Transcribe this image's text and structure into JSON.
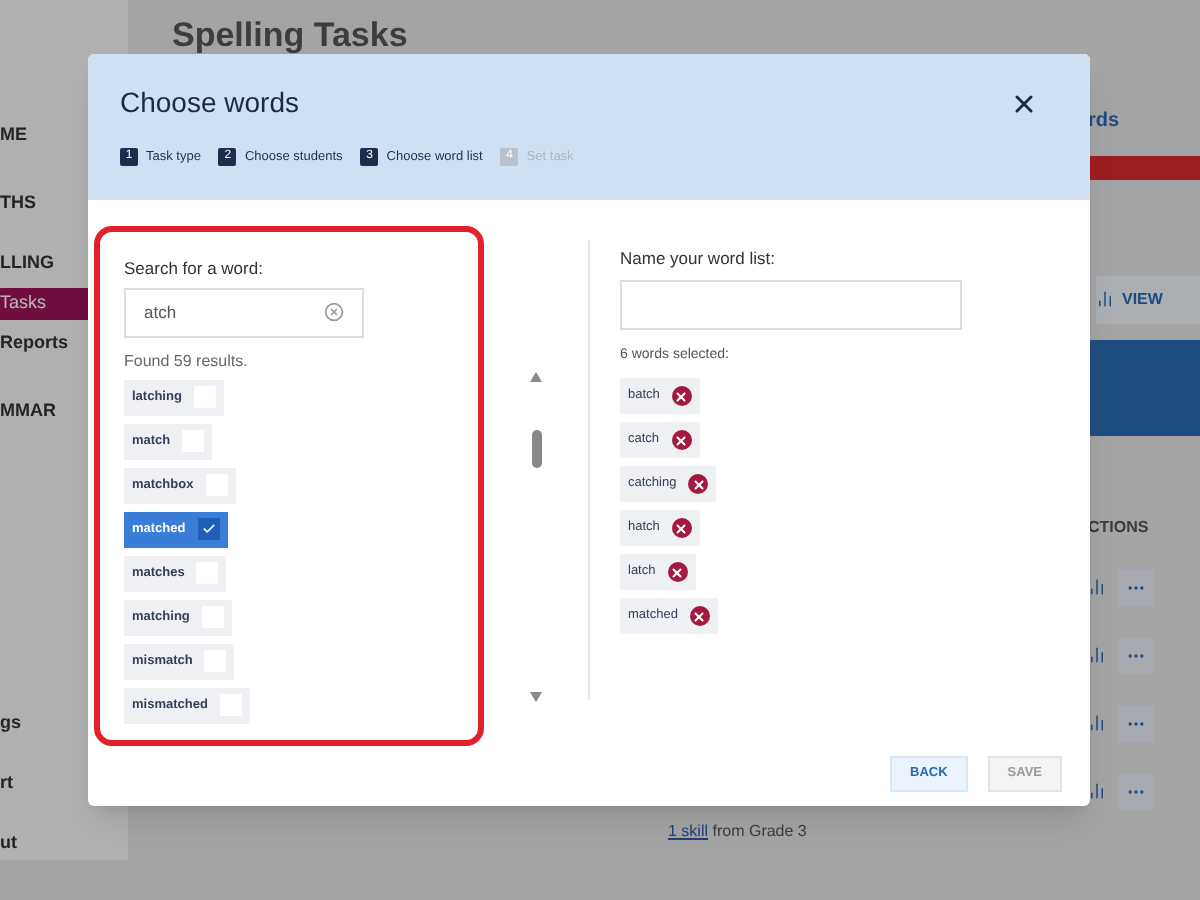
{
  "background": {
    "sidebar": {
      "items": [
        {
          "label": "ME",
          "selected": false
        },
        {
          "label": "THS",
          "selected": false
        },
        {
          "label": "LLING",
          "selected": false
        },
        {
          "label": "Tasks",
          "selected": true
        },
        {
          "label": "Reports",
          "selected": false
        },
        {
          "label": "MMAR",
          "selected": false
        },
        {
          "label": "gs",
          "selected": false
        },
        {
          "label": "rt",
          "selected": false
        },
        {
          "label": "ut",
          "selected": false
        }
      ]
    },
    "page_title": "Spelling Tasks",
    "side_link": "rds",
    "view_button": "VIEW",
    "column_heading": "CTIONS",
    "footnote": {
      "link": "1 skill",
      "text": "from Grade 3"
    }
  },
  "dialog": {
    "title": "Choose words",
    "steps": [
      {
        "number": "1",
        "label": "Task type",
        "disabled": false
      },
      {
        "number": "2",
        "label": "Choose students",
        "disabled": false
      },
      {
        "number": "3",
        "label": "Choose word list",
        "disabled": false
      },
      {
        "number": "4",
        "label": "Set task",
        "disabled": true
      }
    ],
    "search": {
      "label": "Search for a word:",
      "value": "atch",
      "result_count": "Found 59 results.",
      "results": [
        {
          "word": "latching",
          "checked": false
        },
        {
          "word": "match",
          "checked": false
        },
        {
          "word": "matchbox",
          "checked": false
        },
        {
          "word": "matched",
          "checked": true
        },
        {
          "word": "matches",
          "checked": false
        },
        {
          "word": "matching",
          "checked": false
        },
        {
          "word": "mismatch",
          "checked": false
        },
        {
          "word": "mismatched",
          "checked": false
        }
      ]
    },
    "word_list": {
      "label": "Name your word list:",
      "selected_count": "6 words selected:",
      "words": [
        "batch",
        "catch",
        "catching",
        "hatch",
        "latch",
        "matched"
      ]
    },
    "buttons": [
      {
        "label": "BACK",
        "disabled": false
      },
      {
        "label": "SAVE",
        "disabled": true
      }
    ]
  }
}
